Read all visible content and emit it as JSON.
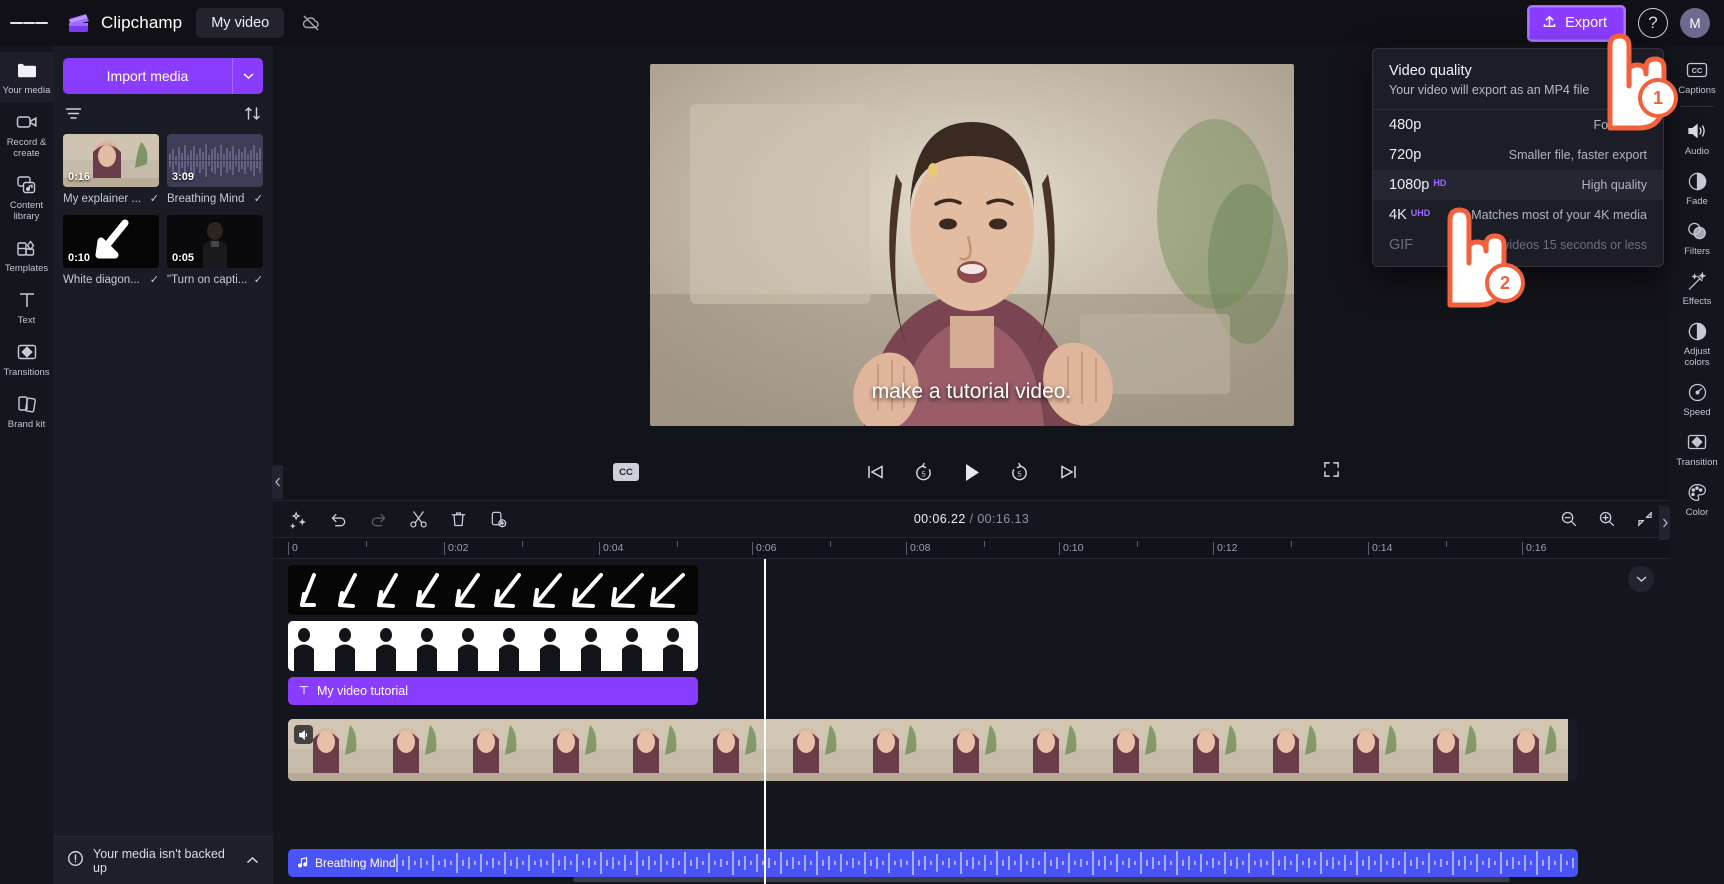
{
  "topbar": {
    "menu_icon": "hamburger-icon",
    "brand": "Clipchamp",
    "project_tab": "My video",
    "cloud_icon": "cloud-off-icon",
    "export_label": "Export",
    "export_icon": "upload-icon",
    "help_label": "?",
    "avatar_initial": "M"
  },
  "left_rail": [
    {
      "label": "Your media",
      "icon": "folder-icon",
      "active": true
    },
    {
      "label": "Record & create",
      "icon": "video-camera-icon",
      "active": false
    },
    {
      "label": "Content library",
      "icon": "content-library-icon",
      "active": false
    },
    {
      "label": "Templates",
      "icon": "templates-icon",
      "active": false
    },
    {
      "label": "Text",
      "icon": "text-t-icon",
      "active": false
    },
    {
      "label": "Transitions",
      "icon": "transitions-icon",
      "active": false
    },
    {
      "label": "Brand kit",
      "icon": "brand-kit-icon",
      "active": false
    }
  ],
  "media_panel": {
    "import_label": "Import media",
    "import_caret_icon": "chevron-down-icon",
    "filter_icon": "filter-icon",
    "sort_icon": "sort-arrows-icon",
    "items": [
      {
        "name": "My explainer ...",
        "duration": "0:16",
        "kind": "video",
        "check": "check-icon"
      },
      {
        "name": "Breathing Mind",
        "duration": "3:09",
        "kind": "audio",
        "check": "check-icon"
      },
      {
        "name": "White diagon...",
        "duration": "0:10",
        "kind": "video",
        "check": "check-icon"
      },
      {
        "name": "\"Turn on capti...",
        "duration": "0:05",
        "kind": "video",
        "check": "check-icon"
      }
    ],
    "backup_warning": "Your media isn't backed up",
    "backup_icon": "warning-circle-icon",
    "backup_chevron": "chevron-up-icon",
    "collapse_icon": "chevron-left-icon"
  },
  "preview": {
    "caption": "make a tutorial video.",
    "cc_label": "CC",
    "controls": [
      {
        "name": "skip-to-start-button",
        "icon": "skip-back-icon"
      },
      {
        "name": "rewind-5-button",
        "icon": "rewind-5-icon"
      },
      {
        "name": "play-button",
        "icon": "play-icon"
      },
      {
        "name": "forward-5-button",
        "icon": "forward-5-icon"
      },
      {
        "name": "skip-to-end-button",
        "icon": "skip-forward-icon"
      }
    ],
    "fullscreen_icon": "fullscreen-icon"
  },
  "timeline": {
    "tools": [
      {
        "name": "magic-wand-button",
        "icon": "sparkle-wand-icon",
        "disabled": false
      },
      {
        "name": "undo-button",
        "icon": "undo-arrow-icon",
        "disabled": false
      },
      {
        "name": "redo-button",
        "icon": "redo-arrow-icon",
        "disabled": true
      },
      {
        "name": "split-button",
        "icon": "scissors-icon",
        "disabled": false
      },
      {
        "name": "delete-button",
        "icon": "trash-icon",
        "disabled": false
      },
      {
        "name": "duplicate-button",
        "icon": "duplicate-icon",
        "disabled": false
      }
    ],
    "current_time": "00:06.22",
    "separator": "/",
    "total_time": "00:16.13",
    "zoom_out_icon": "zoom-out-icon",
    "zoom_in_icon": "zoom-in-icon",
    "fit_icon": "fit-to-screen-icon",
    "ruler_labels": [
      "0",
      "0:02",
      "0:04",
      "0:06",
      "0:08",
      "0:10",
      "0:12",
      "0:14",
      "0:16"
    ],
    "playhead_time": "00:06.22",
    "clips": [
      {
        "name": "white-diagonal-arrow-clip",
        "track": 0,
        "label": "",
        "type": "video-strip"
      },
      {
        "name": "people-strip-clip",
        "track": 1,
        "label": "",
        "type": "video-strip"
      },
      {
        "name": "text-clip",
        "track": 2,
        "label": "My video tutorial",
        "type": "text",
        "icon": "text-t-icon"
      },
      {
        "name": "main-video-clip",
        "track": 3,
        "label": "",
        "type": "video",
        "icon": "speaker-icon"
      },
      {
        "name": "audio-clip",
        "track": 4,
        "label": "Breathing Mind",
        "type": "audio",
        "icon": "music-note-icon"
      }
    ]
  },
  "export_menu": {
    "title": "Video quality",
    "subtitle": "Your video will export as an MP4 file",
    "options": [
      {
        "name": "480p",
        "tag": "",
        "desc": "For drafts",
        "selected": false,
        "disabled": false
      },
      {
        "name": "720p",
        "tag": "",
        "desc": "Smaller file, faster export",
        "selected": false,
        "disabled": false
      },
      {
        "name": "1080p",
        "tag": "HD",
        "desc": "High quality",
        "selected": true,
        "disabled": false
      },
      {
        "name": "4K",
        "tag": "UHD",
        "desc": "Matches most of your 4K media",
        "selected": false,
        "disabled": false
      },
      {
        "name": "GIF",
        "tag": "",
        "desc": "For videos 15 seconds or less",
        "selected": false,
        "disabled": true
      }
    ]
  },
  "right_rail": [
    {
      "label": "Captions",
      "icon": "cc-icon"
    },
    {
      "label": "Audio",
      "icon": "speaker-icon"
    },
    {
      "label": "Fade",
      "icon": "fade-circle-icon"
    },
    {
      "label": "Filters",
      "icon": "filters-circles-icon"
    },
    {
      "label": "Effects",
      "icon": "magic-wand-icon"
    },
    {
      "label": "Adjust colors",
      "icon": "half-circle-icon"
    },
    {
      "label": "Speed",
      "icon": "speedometer-icon"
    },
    {
      "label": "Transition",
      "icon": "transitions-icon"
    },
    {
      "label": "Color",
      "icon": "palette-icon"
    }
  ],
  "callouts": [
    {
      "number": "1",
      "target": "export-button"
    },
    {
      "number": "2",
      "target": "1080p-option"
    }
  ],
  "colors": {
    "accent": "#8b3dff",
    "audio_clip": "#4a53f5",
    "callout": "#f2603c",
    "app_bg": "#13131a",
    "panel_bg": "#1b1b26"
  }
}
